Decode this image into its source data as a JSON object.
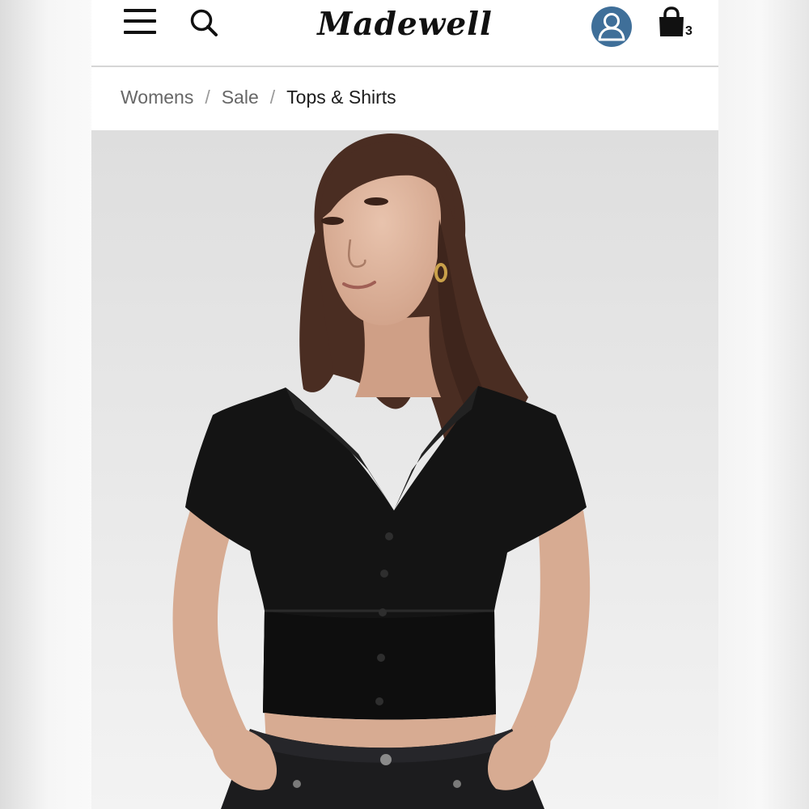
{
  "header": {
    "menu_icon": "hamburger-menu-icon",
    "search_icon": "search-icon",
    "brand": "Madewell",
    "account_icon": "user-account-icon",
    "account_color": "#3f6f99",
    "cart_icon": "shopping-bag-icon",
    "cart_count": "3"
  },
  "breadcrumb": {
    "items": [
      {
        "label": "Womens"
      },
      {
        "label": "Sale"
      },
      {
        "label": "Tops & Shirts"
      }
    ],
    "separator": "/"
  },
  "product_image": {
    "subject": "woman wearing black cropped button-front short-sleeve top with dark jeans"
  }
}
